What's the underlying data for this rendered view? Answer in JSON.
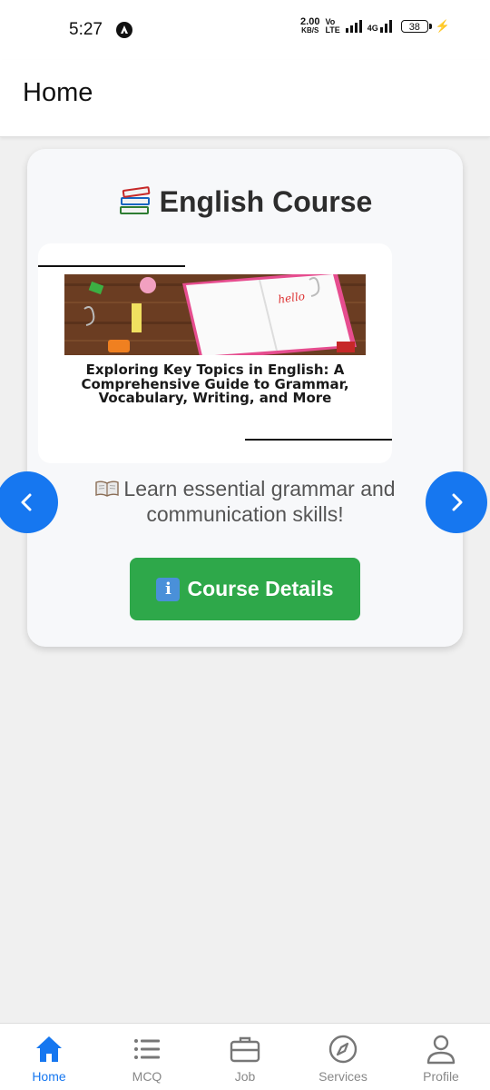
{
  "status_bar": {
    "time": "5:27",
    "net_speed_value": "2.00",
    "net_speed_unit": "KB/S",
    "volte_top": "Vo",
    "volte_bottom": "LTE",
    "network_type": "4G",
    "battery": "38"
  },
  "header": {
    "title": "Home"
  },
  "course_card": {
    "title": "English Course",
    "title_icon": "books-emoji",
    "slide": {
      "caption": "Exploring Key Topics in English: A Comprehensive Guide to Grammar, Vocabulary, Writing, and More",
      "image_icon": "notebook-desk-photo"
    },
    "description_icon": "open-book-emoji",
    "description": "Learn essential grammar and communication skills!",
    "button_icon": "info-icon",
    "button_label": "Course Details",
    "button_color": "#2ea84a"
  },
  "carousel": {
    "prev_icon": "chevron-left-icon",
    "next_icon": "chevron-right-icon",
    "arrow_color": "#1677f0"
  },
  "bottom_nav": {
    "active_color": "#1677f0",
    "items": [
      {
        "label": "Home",
        "icon": "home-icon"
      },
      {
        "label": "MCQ",
        "icon": "list-icon"
      },
      {
        "label": "Job",
        "icon": "briefcase-icon"
      },
      {
        "label": "Services",
        "icon": "compass-icon"
      },
      {
        "label": "Profile",
        "icon": "user-icon"
      }
    ]
  }
}
